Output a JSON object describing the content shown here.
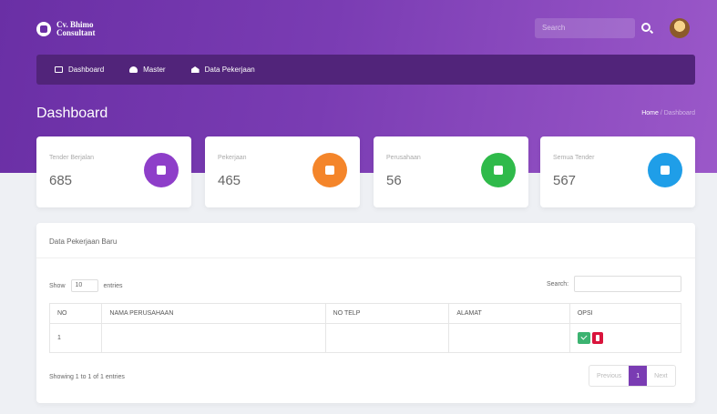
{
  "app": {
    "name": "Cv. Bhimo Consultant"
  },
  "topbar": {
    "search_placeholder": "Search"
  },
  "nav": {
    "items": [
      {
        "label": "Dashboard",
        "icon": "monitor-icon"
      },
      {
        "label": "Master",
        "icon": "cloud-icon"
      },
      {
        "label": "Data Pekerjaan",
        "icon": "home-icon"
      }
    ]
  },
  "page": {
    "title": "Dashboard",
    "breadcrumb": [
      "Home",
      "Dashboard"
    ]
  },
  "stats": [
    {
      "label": "Tender Berjalan",
      "value": "685",
      "color": "#8e3ec9"
    },
    {
      "label": "Pekerjaan",
      "value": "465",
      "color": "#f4852a"
    },
    {
      "label": "Perusahaan",
      "value": "56",
      "color": "#2fba4a"
    },
    {
      "label": "Semua Tender",
      "value": "567",
      "color": "#1f9ee8"
    }
  ],
  "panel": {
    "title": "Data Pekerjaan Baru",
    "show_label": "Show",
    "entries_value": "10",
    "entries_label": "entries",
    "search_label": "Search:",
    "columns": [
      "NO",
      "NAMA PERUSAHAAN",
      "NO TELP",
      "ALAMAT",
      "OPSI"
    ],
    "rows": [
      {
        "no": "1",
        "nama": "",
        "telp": "",
        "alamat": ""
      }
    ],
    "info": "Showing 1 to 1 of 1 entries",
    "pagination": {
      "previous": "Previous",
      "current": "1",
      "next": "Next"
    }
  },
  "colors": {
    "accent": "#7a3cb3",
    "nav_bg": "#51247a",
    "ok": "#3cb371",
    "delete": "#d9143c"
  }
}
